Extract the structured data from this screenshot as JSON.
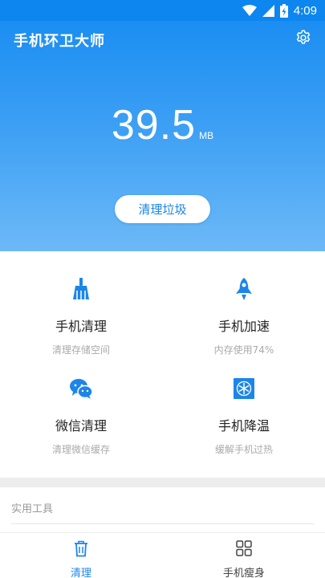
{
  "status": {
    "time": "4:09",
    "icons": [
      "wifi-icon",
      "signal-icon",
      "battery-charging-icon"
    ]
  },
  "header": {
    "title": "手机环卫大师",
    "settings_icon": "gear-icon"
  },
  "junk": {
    "value": "39.5",
    "unit": "MB"
  },
  "clean_button": {
    "label": "清理垃圾"
  },
  "features": [
    {
      "title": "手机清理",
      "subtitle": "清理存储空间",
      "icon": "broom-icon"
    },
    {
      "title": "手机加速",
      "subtitle": "内存使用74%",
      "icon": "rocket-icon"
    },
    {
      "title": "微信清理",
      "subtitle": "清理微信缓存",
      "icon": "wechat-icon"
    },
    {
      "title": "手机降温",
      "subtitle": "缓解手机过热",
      "icon": "snowflake-icon"
    }
  ],
  "tools": {
    "title": "实用工具"
  },
  "tabs": [
    {
      "label": "清理",
      "icon": "trash-icon",
      "active": true
    },
    {
      "label": "手机瘦身",
      "icon": "grid-icon",
      "active": false
    }
  ],
  "colors": {
    "primary": "#1c86e8",
    "hero_top": "#1b8ef2",
    "hero_bottom": "#6db9f7"
  }
}
